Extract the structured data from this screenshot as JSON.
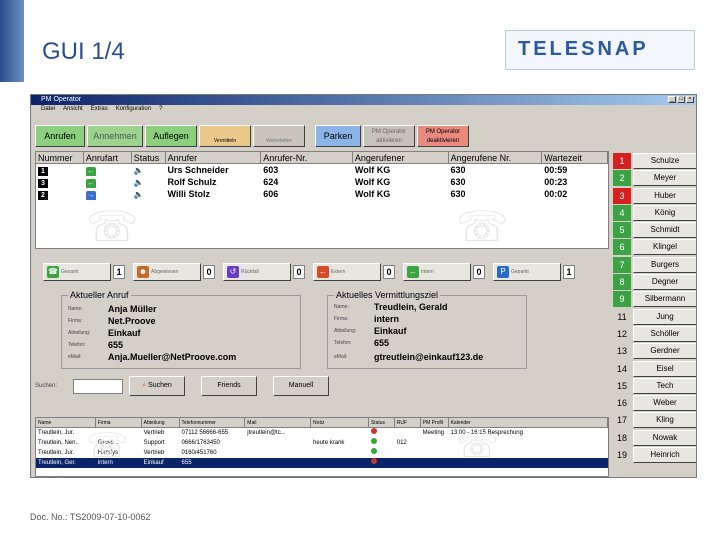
{
  "slide": {
    "title": "GUI 1/4",
    "logo_text": "TELESNAP",
    "doc_no": "Doc. No.: TS2009-07-10-0062"
  },
  "app": {
    "window_title": "PM Operator",
    "window_buttons": [
      "_",
      "□",
      "×"
    ],
    "menu": [
      "Datei",
      "Ansicht",
      "Extras",
      "Konfiguration",
      "?"
    ]
  },
  "toolbar": {
    "anrufen": "Anrufen",
    "annehmen": "Annehmen",
    "auflegen": "Auflegen",
    "vermitteln": "Vermitteln",
    "weiterleiten": "Weiterleiten",
    "parken": "Parken",
    "pm_aktivieren": "PM Operator aktivieren",
    "pm_deaktivieren": "PM Operator deaktivieren"
  },
  "calls": {
    "headers": [
      "Nummer",
      "Anrufart",
      "Status",
      "Anrufer",
      "Anrufer-Nr.",
      "Angerufener",
      "Angerufene Nr.",
      "Wartezeit"
    ],
    "rows": [
      {
        "num": "1",
        "arrow": "←",
        "status": "🔈",
        "caller": "Urs Schneider",
        "caller_nr": "603",
        "callee": "Wolf KG",
        "callee_nr": "630",
        "wait": "00:59"
      },
      {
        "num": "3",
        "arrow": "←",
        "status": "🔈",
        "caller": "Rolf Schulz",
        "caller_nr": "624",
        "callee": "Wolf KG",
        "callee_nr": "630",
        "wait": "00:23"
      },
      {
        "num": "2",
        "arrow": "→",
        "status": "🔈",
        "caller": "Willi Stolz",
        "caller_nr": "606",
        "callee": "Wolf KG",
        "callee_nr": "630",
        "wait": "00:02"
      }
    ]
  },
  "counters": [
    {
      "label": "Gesamt",
      "value": "1",
      "icon": "phone-icon",
      "color": "#3ba341"
    },
    {
      "label": "Abgewiesen",
      "value": "0",
      "icon": "person-icon",
      "color": "#c46a2a"
    },
    {
      "label": "Rückfall",
      "value": "0",
      "icon": "return-icon",
      "color": "#6a3ac7"
    },
    {
      "label": "Extern",
      "value": "0",
      "icon": "arrow-left-icon",
      "color": "#d44a2a"
    },
    {
      "label": "Intern",
      "value": "0",
      "icon": "arrow-left-icon",
      "color": "#3ba341"
    },
    {
      "label": "Geparkt",
      "value": "1",
      "icon": "parking-icon",
      "color": "#2a6ac7"
    }
  ],
  "current_call": {
    "title": "Aktueller Anruf",
    "fields": [
      {
        "label": "Name:",
        "value": "Anja Müller"
      },
      {
        "label": "Firma:",
        "value": "Net.Proove"
      },
      {
        "label": "Abteilung:",
        "value": "Einkauf"
      },
      {
        "label": "Telefon:",
        "value": "655"
      },
      {
        "label": "eMail:",
        "value": "Anja.Mueller@NetProove.com"
      }
    ]
  },
  "current_target": {
    "title": "Aktuelles Vermittlungsziel",
    "fields": [
      {
        "label": "Name:",
        "value": "Treudlein, Gerald"
      },
      {
        "label": "Firma:",
        "value": "intern"
      },
      {
        "label": "Abteilung:",
        "value": "Einkauf"
      },
      {
        "label": "Telefon:",
        "value": "655"
      },
      {
        "label": "eMail:",
        "value": "gtreutlein@einkauf123.de"
      }
    ]
  },
  "search": {
    "label": "Suchen:",
    "value": "",
    "search_button": "Suchen",
    "friends_button": "Friends",
    "manual_button": "Manuell"
  },
  "directory": {
    "headers": [
      "Name",
      "Firma",
      "Abteilung",
      "Telefonnummer",
      "Mail",
      "Notiz",
      "Status",
      "RUF",
      "PM Profil",
      "Kalender"
    ],
    "rows": [
      {
        "name": "Treutlein, Jur.",
        "firma": "",
        "abt": "Vertrieb",
        "tel": "07112 56666-655",
        "mail": "jtreutlein@tc...",
        "notiz": "",
        "status": "#c33",
        "ruf": "",
        "pm": "Meeting",
        "kal": "13:00 - 16:15 Besprechung",
        "sel": false
      },
      {
        "name": "Treutlein, Nen..",
        "firma": "Gross...",
        "abt": "Support",
        "tel": "0666/1763450",
        "mail": "",
        "notiz": "heute krank",
        "status": "#3a3",
        "ruf": "012",
        "pm": "",
        "kal": "",
        "sel": false
      },
      {
        "name": "Treutlein, Jur.",
        "firma": "Handys",
        "abt": "Vertrieb",
        "tel": "0160/451760",
        "mail": "",
        "notiz": "",
        "status": "#3a3",
        "ruf": "",
        "pm": "",
        "kal": "",
        "sel": false
      },
      {
        "name": "Treutlein, Ger.",
        "firma": "intern",
        "abt": "Einkauf",
        "tel": "655",
        "mail": "",
        "notiz": "",
        "status": "#c33",
        "ruf": "",
        "pm": "",
        "kal": "",
        "sel": true
      }
    ]
  },
  "speed_dial": [
    {
      "num": "1",
      "name": "Schulze",
      "color": "#d62020"
    },
    {
      "num": "2",
      "name": "Meyer",
      "color": "#3ba341"
    },
    {
      "num": "3",
      "name": "Huber",
      "color": "#d62020"
    },
    {
      "num": "4",
      "name": "König",
      "color": "#3ba341"
    },
    {
      "num": "5",
      "name": "Schmidt",
      "color": "#3ba341"
    },
    {
      "num": "6",
      "name": "Klingel",
      "color": "#3ba341"
    },
    {
      "num": "7",
      "name": "Burgers",
      "color": "#3ba341"
    },
    {
      "num": "8",
      "name": "Degner",
      "color": "#3ba341"
    },
    {
      "num": "9",
      "name": "Silbermann",
      "color": "#3ba341"
    },
    {
      "num": "11",
      "name": "Jung",
      "color": "#d4d0c8"
    },
    {
      "num": "12",
      "name": "Schöller",
      "color": "#d4d0c8"
    },
    {
      "num": "13",
      "name": "Gerdner",
      "color": "#d4d0c8"
    },
    {
      "num": "14",
      "name": "Eisel",
      "color": "#d4d0c8"
    },
    {
      "num": "15",
      "name": "Tech",
      "color": "#d4d0c8"
    },
    {
      "num": "16",
      "name": "Weber",
      "color": "#d4d0c8"
    },
    {
      "num": "17",
      "name": "Kling",
      "color": "#d4d0c8"
    },
    {
      "num": "18",
      "name": "Nowak",
      "color": "#d4d0c8"
    },
    {
      "num": "19",
      "name": "Heinrich",
      "color": "#d4d0c8"
    }
  ]
}
